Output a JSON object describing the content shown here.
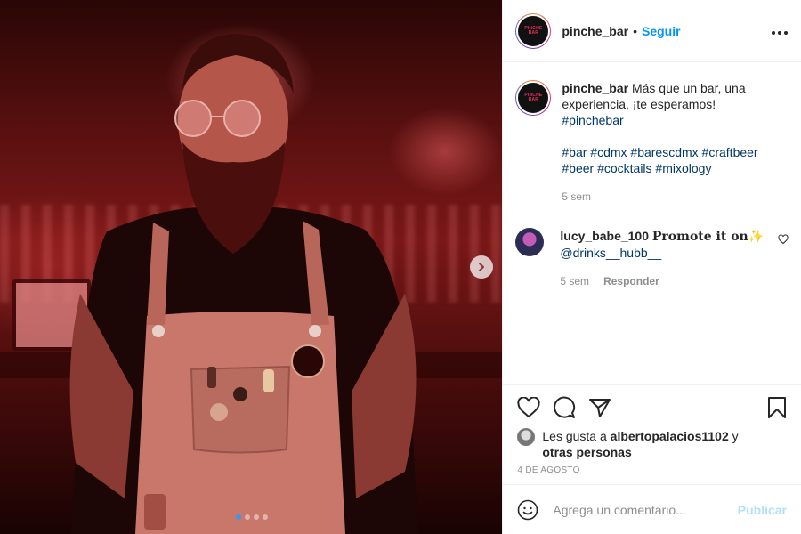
{
  "photo": {
    "alt_icon": "person-photo",
    "carousel": {
      "next_icon": "chevron-right-icon",
      "slide_count": 4,
      "active_index": 0
    }
  },
  "header": {
    "username": "pinche_bar",
    "bullet": "•",
    "follow_label": "Seguir",
    "more_label": "•••"
  },
  "caption": {
    "username": "pinche_bar",
    "text": "Más que un bar, una experiencia, ¡te esperamos!",
    "hashtag_line1": "#pinchebar",
    "hashtag_line2": "#bar #cdmx #barescdmx #craftbeer",
    "hashtag_line3": "#beer #cocktails #mixology",
    "time": "5 sem"
  },
  "comment": {
    "username": "lucy_babe_100",
    "text": "Promote it on✨",
    "mention": "@drinks__hubb__",
    "time": "5 sem",
    "reply_label": "Responder"
  },
  "actions": {
    "likes_prefix": "Les gusta a",
    "likes_user": "albertopalacios1102",
    "likes_connector": "y",
    "likes_others": "otras personas",
    "date": "4 DE AGOSTO"
  },
  "add_comment": {
    "placeholder": "Agrega un comentario...",
    "publish_label": "Publicar"
  },
  "colors": {
    "follow": "#0095f6",
    "hashtag": "#00376b",
    "muted": "#8e8e8e",
    "publish_disabled": "#b2dffc",
    "carousel_active": "#3897f0"
  }
}
